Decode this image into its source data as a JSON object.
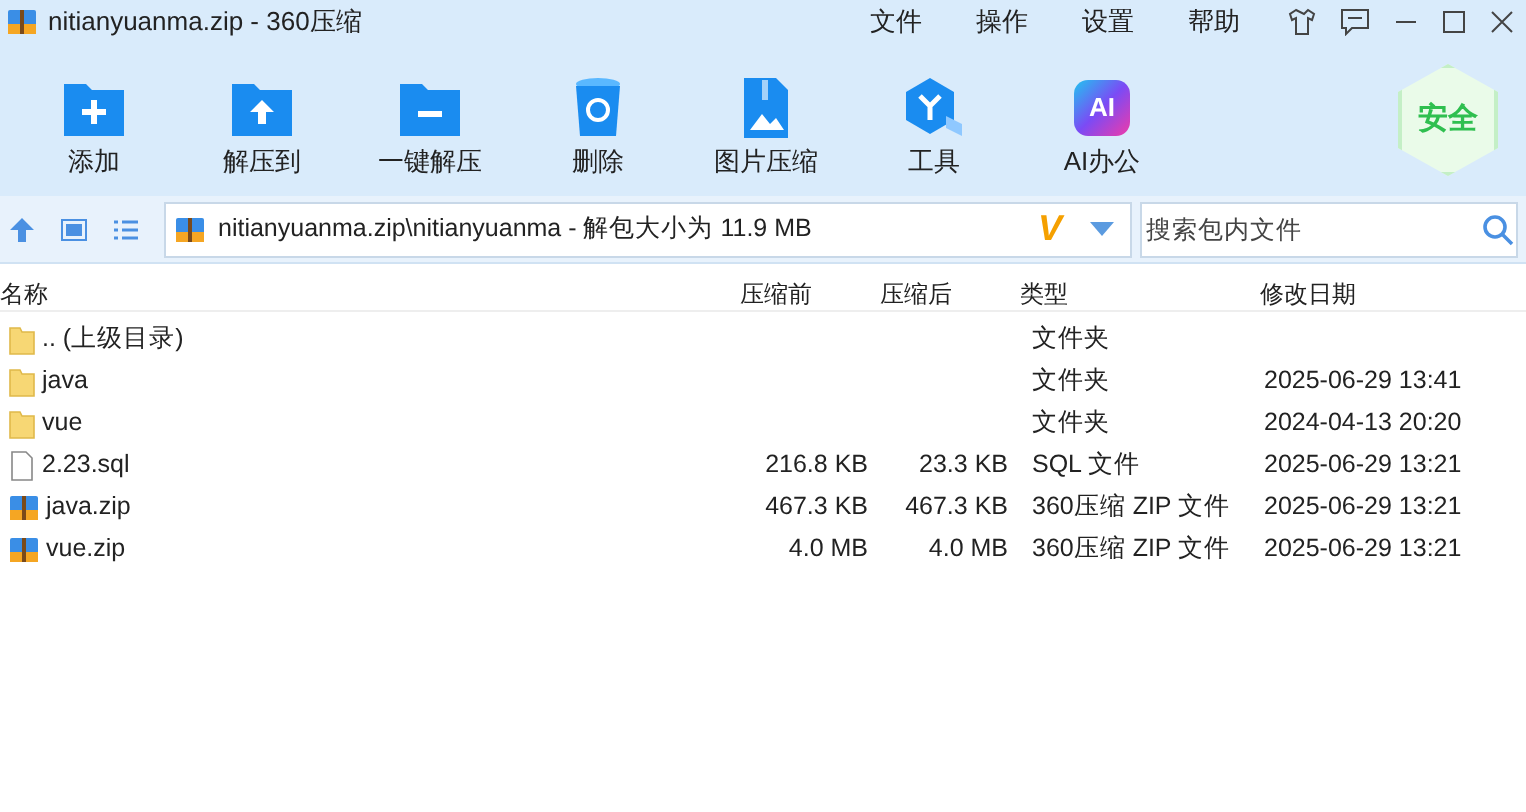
{
  "window": {
    "title": "nitianyuanma.zip - 360压缩"
  },
  "menu": [
    "文件",
    "操作",
    "设置",
    "帮助"
  ],
  "toolbar": [
    {
      "kind": "add",
      "label": "添加"
    },
    {
      "kind": "extract-to",
      "label": "解压到"
    },
    {
      "kind": "extract",
      "label": "一键解压"
    },
    {
      "kind": "delete",
      "label": "删除"
    },
    {
      "kind": "image",
      "label": "图片压缩"
    },
    {
      "kind": "tools",
      "label": "工具"
    },
    {
      "kind": "ai",
      "label": "AI办公",
      "badge": "AI"
    }
  ],
  "security_badge": "安全",
  "address": {
    "path": "nitianyuanma.zip\\nitianyuanma - 解包大小为 11.9 MB",
    "logo": "V"
  },
  "search": {
    "placeholder": "搜索包内文件"
  },
  "table": {
    "columns": [
      "名称",
      "压缩前",
      "压缩后",
      "类型",
      "修改日期"
    ],
    "rows": [
      {
        "kind": "folder",
        "name": ".. (上级目录)",
        "type": "文件夹"
      },
      {
        "kind": "folder",
        "name": "java",
        "type": "文件夹",
        "date": "2025-06-29 13:41"
      },
      {
        "kind": "folder",
        "name": "vue",
        "type": "文件夹",
        "date": "2024-04-13 20:20"
      },
      {
        "kind": "file",
        "name": "2.23.sql",
        "before": "216.8 KB",
        "after": "23.3 KB",
        "type": "SQL 文件",
        "date": "2025-06-29 13:21"
      },
      {
        "kind": "zip",
        "name": "java.zip",
        "before": "467.3 KB",
        "after": "467.3 KB",
        "type": "360压缩 ZIP 文件",
        "date": "2025-06-29 13:21"
      },
      {
        "kind": "zip",
        "name": "vue.zip",
        "before": "4.0 MB",
        "after": "4.0 MB",
        "type": "360压缩 ZIP 文件",
        "date": "2025-06-29 13:21"
      }
    ]
  }
}
